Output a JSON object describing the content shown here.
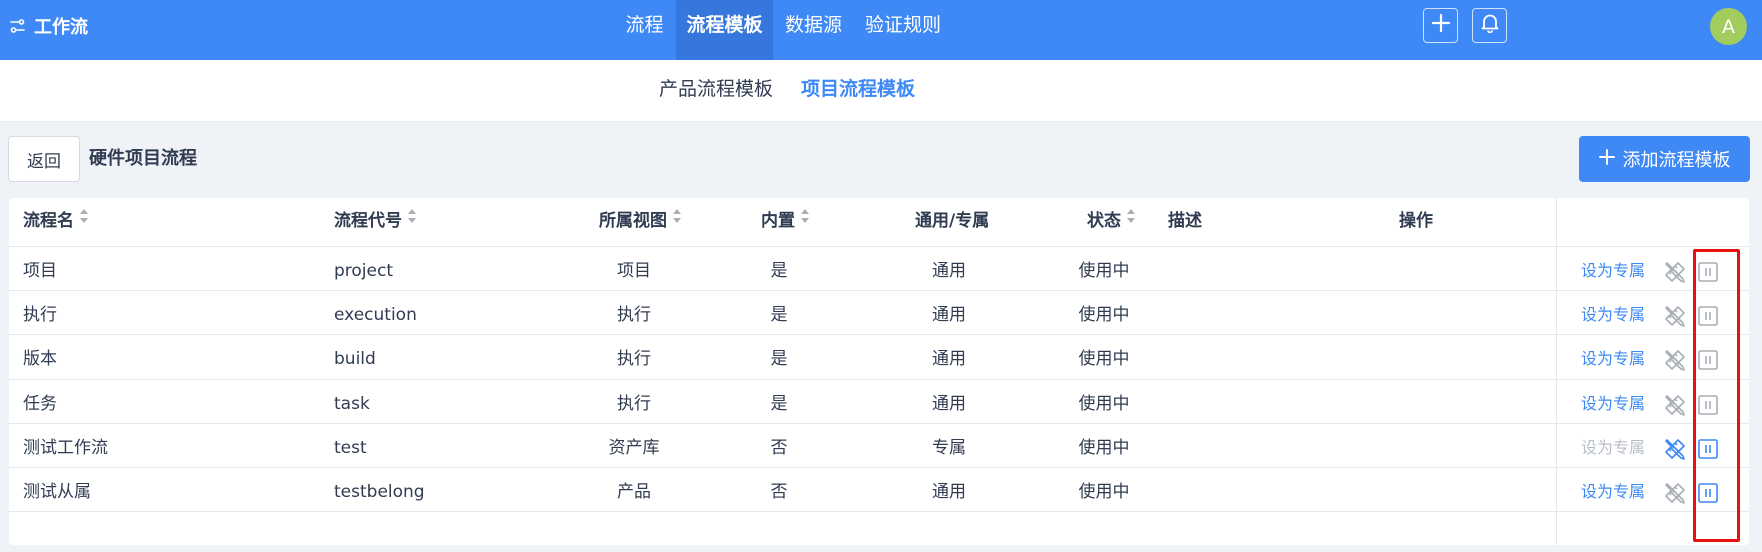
{
  "app": {
    "title": "工作流",
    "nav": [
      "流程",
      "流程模板",
      "数据源",
      "验证规则"
    ],
    "nav_active": 1,
    "avatar_letter": "A"
  },
  "subtabs": [
    "产品流程模板",
    "项目流程模板"
  ],
  "subtab_active": 1,
  "toolbar": {
    "back_label": "返回",
    "page_title": "硬件项目流程",
    "add_label": "添加流程模板"
  },
  "table": {
    "columns": {
      "name": "流程名",
      "code": "流程代号",
      "view": "所属视图",
      "builtin": "内置",
      "scope": "通用/专属",
      "status": "状态",
      "desc": "描述",
      "actions": "操作"
    },
    "rows": [
      {
        "name": "项目",
        "code": "project",
        "view": "项目",
        "builtin": "是",
        "scope": "通用",
        "status": "使用中",
        "desc": "",
        "action_label": "设为专属",
        "action_enabled": true,
        "edit_active": false,
        "pause_active": false
      },
      {
        "name": "执行",
        "code": "execution",
        "view": "执行",
        "builtin": "是",
        "scope": "通用",
        "status": "使用中",
        "desc": "",
        "action_label": "设为专属",
        "action_enabled": true,
        "edit_active": false,
        "pause_active": false
      },
      {
        "name": "版本",
        "code": "build",
        "view": "执行",
        "builtin": "是",
        "scope": "通用",
        "status": "使用中",
        "desc": "",
        "action_label": "设为专属",
        "action_enabled": true,
        "edit_active": false,
        "pause_active": false
      },
      {
        "name": "任务",
        "code": "task",
        "view": "执行",
        "builtin": "是",
        "scope": "通用",
        "status": "使用中",
        "desc": "",
        "action_label": "设为专属",
        "action_enabled": true,
        "edit_active": false,
        "pause_active": false
      },
      {
        "name": "测试工作流",
        "code": "test",
        "view": "资产库",
        "builtin": "否",
        "scope": "专属",
        "status": "使用中",
        "desc": "",
        "action_label": "设为专属",
        "action_enabled": false,
        "edit_active": true,
        "pause_active": true
      },
      {
        "name": "测试从属",
        "code": "testbelong",
        "view": "产品",
        "builtin": "否",
        "scope": "通用",
        "status": "使用中",
        "desc": "",
        "action_label": "设为专属",
        "action_enabled": true,
        "edit_active": false,
        "pause_active": true
      }
    ]
  },
  "icons": {
    "brand": "workflow-sliders-icon",
    "add": "plus-icon",
    "bell": "bell-icon",
    "sort": "sort-caret-icon",
    "edit": "pencil-ruler-icon",
    "pause": "pause-icon"
  },
  "colors": {
    "primary": "#3e89f5",
    "nav_active_bg": "#3577dd",
    "avatar": "#a3cc5f",
    "disabled": "#b8bec9",
    "icon_inactive": "#a9aeb7",
    "highlight_border": "#e8110f"
  }
}
